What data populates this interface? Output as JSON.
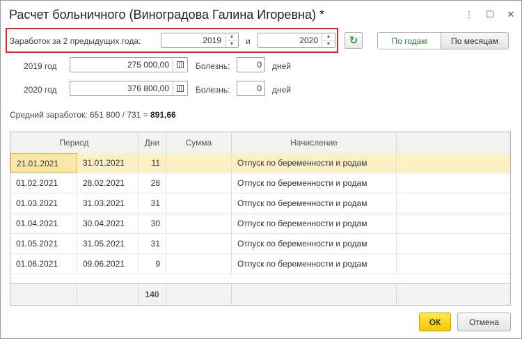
{
  "window": {
    "title": "Расчет больничного (Виноградова Галина Игоревна) *",
    "menu_icon": "⋮",
    "maximize_icon": "☐",
    "close_icon": "✕"
  },
  "period": {
    "label": "Заработок за 2 предыдущих года:",
    "year1": "2019",
    "and_label": "и",
    "year2": "2020",
    "refresh_icon": "↻"
  },
  "toggle": {
    "by_years": "По годам",
    "by_months": "По месяцам",
    "selected": "by_years"
  },
  "years": [
    {
      "label": "2019 год",
      "amount": "275 000,00",
      "illness_label": "Болезнь:",
      "illness_days": "0",
      "days_label": "дней"
    },
    {
      "label": "2020 год",
      "amount": "376 800,00",
      "illness_label": "Болезнь:",
      "illness_days": "0",
      "days_label": "дней"
    }
  ],
  "average": {
    "label": "Средний заработок: 651 800 / 731 =",
    "value": "891,66"
  },
  "table": {
    "headers": {
      "period": "Период",
      "days": "Дни",
      "sum": "Сумма",
      "accrual": "Начисление"
    },
    "rows": [
      {
        "from": "21.01.2021",
        "to": "31.01.2021",
        "days": "11",
        "sum": "",
        "accrual": "Отпуск по беременности и родам"
      },
      {
        "from": "01.02.2021",
        "to": "28.02.2021",
        "days": "28",
        "sum": "",
        "accrual": "Отпуск по беременности и родам"
      },
      {
        "from": "01.03.2021",
        "to": "31.03.2021",
        "days": "31",
        "sum": "",
        "accrual": "Отпуск по беременности и родам"
      },
      {
        "from": "01.04.2021",
        "to": "30.04.2021",
        "days": "30",
        "sum": "",
        "accrual": "Отпуск по беременности и родам"
      },
      {
        "from": "01.05.2021",
        "to": "31.05.2021",
        "days": "31",
        "sum": "",
        "accrual": "Отпуск по беременности и родам"
      },
      {
        "from": "01.06.2021",
        "to": "09.06.2021",
        "days": "9",
        "sum": "",
        "accrual": "Отпуск по беременности и родам"
      }
    ],
    "total_days": "140"
  },
  "buttons": {
    "ok": "ОК",
    "cancel": "Отмена"
  },
  "colors": {
    "highlight": "#d6262b",
    "selected_row": "#fbf0c4",
    "ok_button": "#f4c900",
    "accent_green": "#2a8a3a"
  }
}
